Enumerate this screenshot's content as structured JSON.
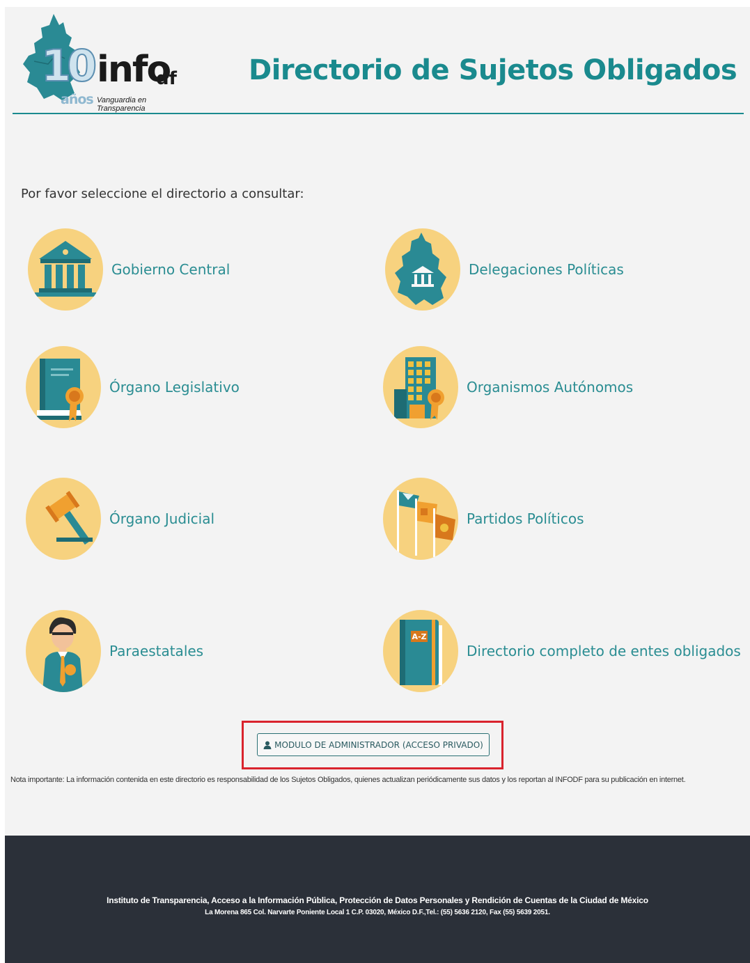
{
  "header": {
    "logo": {
      "number": "10",
      "word": "info",
      "suffix": "df",
      "years": "años",
      "tagline": "Vanguardia en Transparencia"
    },
    "title": "Directorio de Sujetos Obligados"
  },
  "main": {
    "prompt": "Por favor seleccione el directorio a consultar:",
    "directories": [
      {
        "label": "Gobierno Central",
        "icon": "government-building-icon"
      },
      {
        "label": "Delegaciones Políticas",
        "icon": "city-map-icon"
      },
      {
        "label": "Órgano Legislativo",
        "icon": "law-book-icon"
      },
      {
        "label": "Organismos Autónomos",
        "icon": "office-building-icon"
      },
      {
        "label": "Órgano Judicial",
        "icon": "gavel-icon"
      },
      {
        "label": "Partidos Políticos",
        "icon": "flags-icon"
      },
      {
        "label": "Paraestatales",
        "icon": "official-person-icon"
      },
      {
        "label": "Directorio completo de entes obligados",
        "icon": "address-book-icon"
      }
    ],
    "admin_button_label": "MODULO DE ADMINISTRADOR (ACCESO PRIVADO)",
    "admin_icon": "user-icon",
    "note": "Nota importante: La información contenida en este directorio es responsabilidad de los Sujetos Obligados, quienes actualizan periódicamente sus datos y los reportan al INFODF para su publicación en internet."
  },
  "footer": {
    "institute": "Instituto de Transparencia, Acceso a la Información Pública, Protección de Datos Personales y Rendición de Cuentas de la Ciudad de México",
    "address": "La Morena 865 Col. Narvarte Poniente Local 1 C.P. 03020, México D.F.,Tel.: (55) 5636 2120, Fax (55) 5639 2051."
  },
  "colors": {
    "accent": "#1a8a8e",
    "circle": "#f7d27f",
    "footer": "#2b3039",
    "highlight": "#d9232d"
  }
}
